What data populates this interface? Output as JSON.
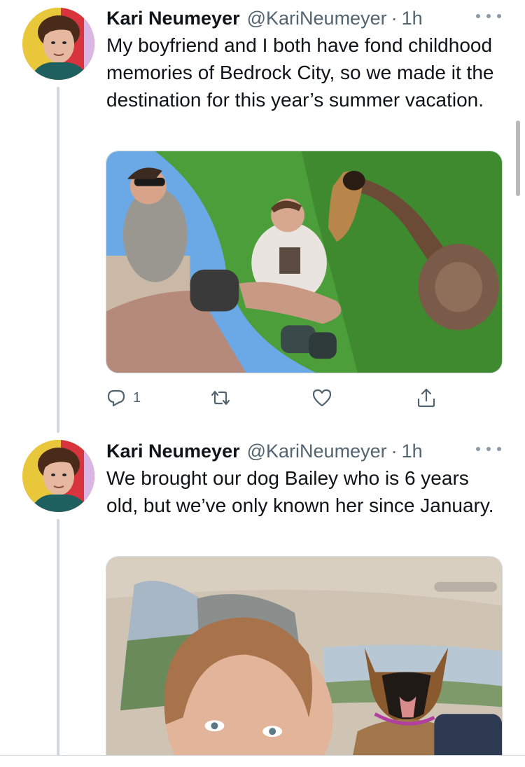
{
  "tweets": [
    {
      "display_name": "Kari Neumeyer",
      "handle": "@KariNeumeyer",
      "separator": "·",
      "time": "1h",
      "text": "My boyfriend and I both have fond childhood memories of Bedrock City, so we made it the destination for this year’s summer vacation.",
      "media_icon": "photo-selfie-fisheye",
      "actions": {
        "reply_count": "1",
        "reply_icon": "reply-icon",
        "retweet_icon": "retweet-icon",
        "like_icon": "heart-icon",
        "share_icon": "share-icon"
      }
    },
    {
      "display_name": "Kari Neumeyer",
      "handle": "@KariNeumeyer",
      "separator": "·",
      "time": "1h",
      "text": "We brought our dog Bailey who is 6 years old, but we’ve only known her since January.",
      "media_icon": "photo-car-selfie-with-dog"
    }
  ],
  "colors": {
    "text_primary": "#0f1419",
    "text_secondary": "#536471",
    "thread_line": "#cfd9de",
    "icon_gray": "#536471"
  }
}
